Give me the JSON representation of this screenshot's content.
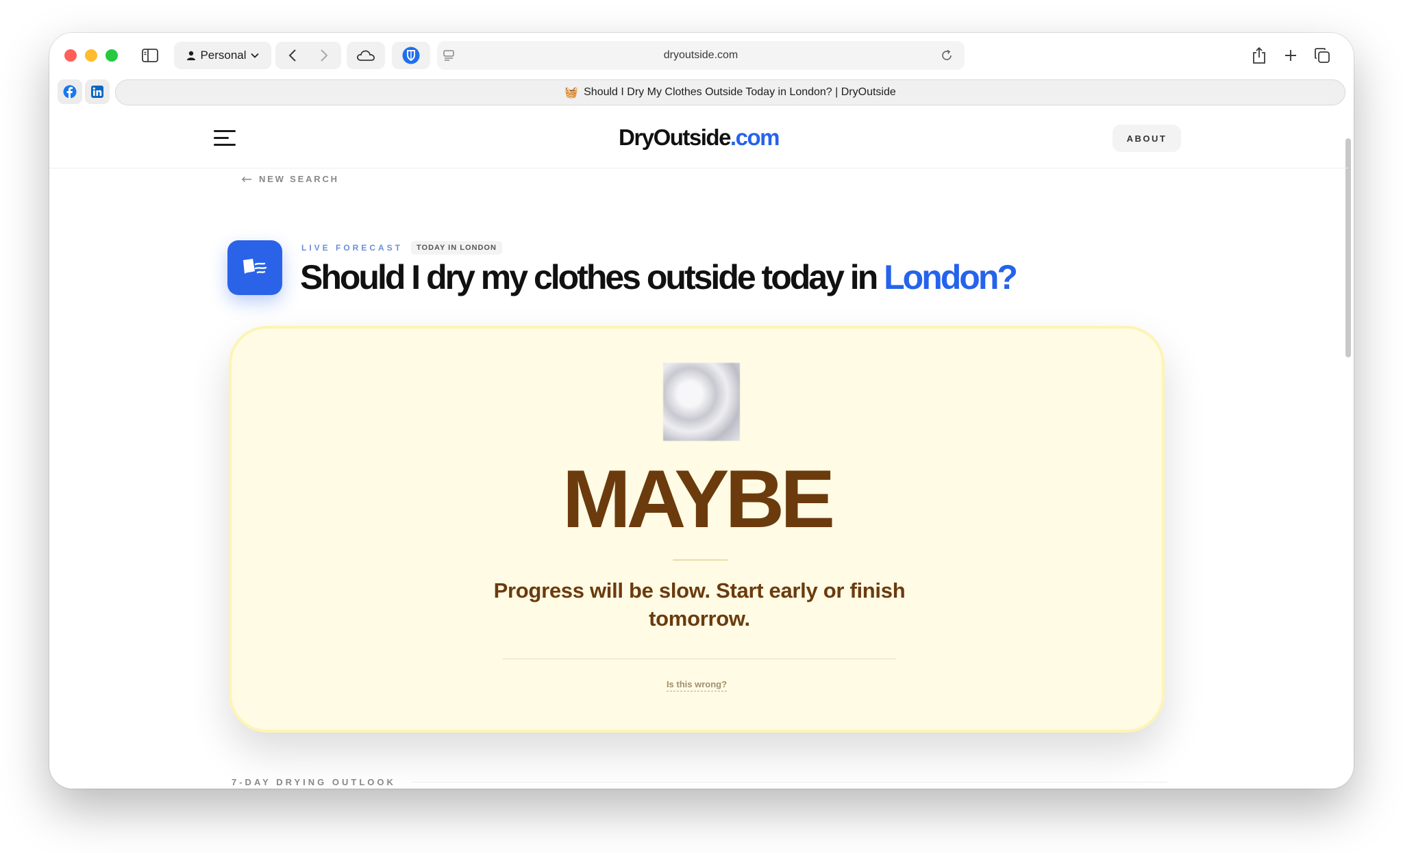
{
  "browser": {
    "profile_label": "Personal",
    "url": "dryoutside.com",
    "tab_title": "Should I Dry My Clothes Outside Today in London? | DryOutside",
    "tab_favicon": "🧺"
  },
  "site": {
    "logo_main": "DryOutside",
    "logo_tld": ".com",
    "about_label": "ABOUT",
    "new_search_label": "NEW SEARCH"
  },
  "hero": {
    "eyebrow_live": "LIVE FORECAST",
    "eyebrow_chip": "TODAY IN LONDON",
    "headline_prefix": "Should I dry my clothes outside today in",
    "headline_city": "London?"
  },
  "verdict": {
    "word": "MAYBE",
    "message": "Progress will be slow. Start early or finish tomorrow.",
    "feedback_link": "Is this wrong?"
  },
  "outlook": {
    "section_label": "7-DAY DRYING OUTLOOK"
  },
  "colors": {
    "accent": "#2563eb",
    "verdict_text": "#6b3b0e",
    "verdict_card_bg": "#fffbe4"
  }
}
